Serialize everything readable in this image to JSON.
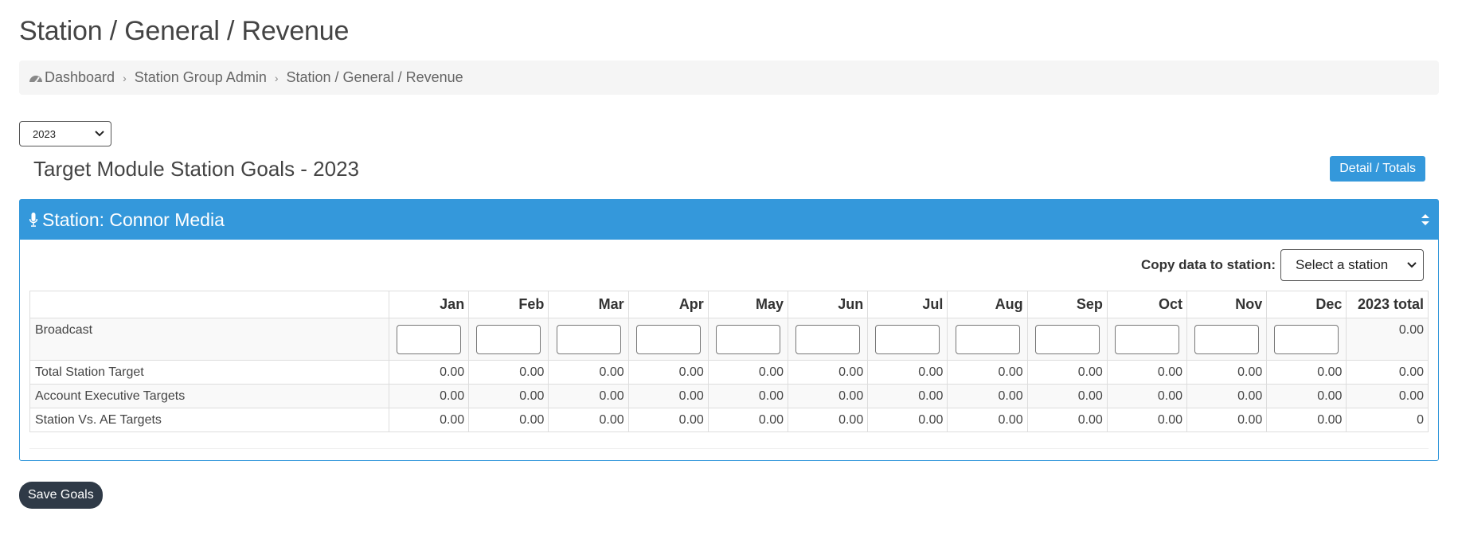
{
  "page": {
    "title": "Station / General / Revenue"
  },
  "breadcrumb": {
    "items": [
      "Dashboard",
      "Station Group Admin",
      "Station / General / Revenue"
    ]
  },
  "year_select": {
    "value": "2023"
  },
  "goals": {
    "title": "Target Module Station Goals - 2023",
    "detail_button": "Detail / Totals"
  },
  "panel": {
    "title": "Station: Connor Media",
    "copy_label": "Copy data to station:",
    "station_select": "Select a station"
  },
  "table": {
    "months": [
      "Jan",
      "Feb",
      "Mar",
      "Apr",
      "May",
      "Jun",
      "Jul",
      "Aug",
      "Sep",
      "Oct",
      "Nov",
      "Dec"
    ],
    "total_header": "2023 total",
    "broadcast": {
      "label": "Broadcast",
      "total": "0.00"
    },
    "rows": [
      {
        "label": "Total Station Target",
        "values": [
          "0.00",
          "0.00",
          "0.00",
          "0.00",
          "0.00",
          "0.00",
          "0.00",
          "0.00",
          "0.00",
          "0.00",
          "0.00",
          "0.00"
        ],
        "total": "0.00"
      },
      {
        "label": "Account Executive Targets",
        "values": [
          "0.00",
          "0.00",
          "0.00",
          "0.00",
          "0.00",
          "0.00",
          "0.00",
          "0.00",
          "0.00",
          "0.00",
          "0.00",
          "0.00"
        ],
        "total": "0.00"
      },
      {
        "label": "Station Vs. AE Targets",
        "values": [
          "0.00",
          "0.00",
          "0.00",
          "0.00",
          "0.00",
          "0.00",
          "0.00",
          "0.00",
          "0.00",
          "0.00",
          "0.00",
          "0.00"
        ],
        "total": "0"
      }
    ]
  },
  "save_button": "Save Goals",
  "colors": {
    "primary": "#3498db",
    "dark_button": "#2f3a47"
  },
  "icons": {
    "breadcrumb_home": "dashboard-icon",
    "panel": "microphone-icon",
    "panel_toggle": "sort-icon"
  }
}
